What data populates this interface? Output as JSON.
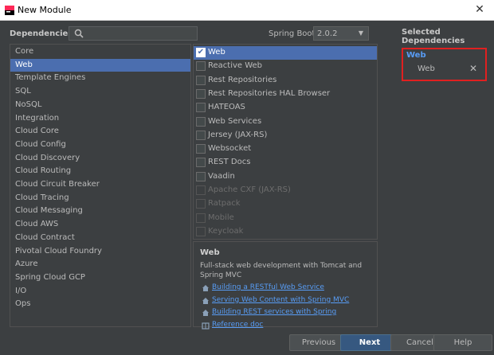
{
  "window": {
    "title": "New Module"
  },
  "toolbar": {
    "dependencies_label": "Dependencies",
    "search_placeholder": "",
    "spring_boot_label": "Spring Boot",
    "spring_boot_version": "2.0.2"
  },
  "categories": [
    "Core",
    "Web",
    "Template Engines",
    "SQL",
    "NoSQL",
    "Integration",
    "Cloud Core",
    "Cloud Config",
    "Cloud Discovery",
    "Cloud Routing",
    "Cloud Circuit Breaker",
    "Cloud Tracing",
    "Cloud Messaging",
    "Cloud AWS",
    "Cloud Contract",
    "Pivotal Cloud Foundry",
    "Azure",
    "Spring Cloud GCP",
    "I/O",
    "Ops"
  ],
  "selected_category_index": 1,
  "dependencies": [
    {
      "label": "Web",
      "checked": true,
      "enabled": true
    },
    {
      "label": "Reactive Web",
      "checked": false,
      "enabled": true
    },
    {
      "label": "Rest Repositories",
      "checked": false,
      "enabled": true
    },
    {
      "label": "Rest Repositories HAL Browser",
      "checked": false,
      "enabled": true
    },
    {
      "label": "HATEOAS",
      "checked": false,
      "enabled": true
    },
    {
      "label": "Web Services",
      "checked": false,
      "enabled": true
    },
    {
      "label": "Jersey (JAX-RS)",
      "checked": false,
      "enabled": true
    },
    {
      "label": "Websocket",
      "checked": false,
      "enabled": true
    },
    {
      "label": "REST Docs",
      "checked": false,
      "enabled": true
    },
    {
      "label": "Vaadin",
      "checked": false,
      "enabled": true
    },
    {
      "label": "Apache CXF (JAX-RS)",
      "checked": false,
      "enabled": false
    },
    {
      "label": "Ratpack",
      "checked": false,
      "enabled": false
    },
    {
      "label": "Mobile",
      "checked": false,
      "enabled": false
    },
    {
      "label": "Keycloak",
      "checked": false,
      "enabled": false
    }
  ],
  "description": {
    "title": "Web",
    "text": "Full-stack web development with Tomcat and Spring MVC",
    "links": [
      {
        "icon": "home-icon",
        "label": "Building a RESTful Web Service"
      },
      {
        "icon": "home-icon",
        "label": "Serving Web Content with Spring MVC"
      },
      {
        "icon": "home-icon",
        "label": "Building REST services with Spring"
      },
      {
        "icon": "book-icon",
        "label": "Reference doc"
      }
    ]
  },
  "selected_dependencies": {
    "label": "Selected Dependencies",
    "group": "Web",
    "items": [
      "Web"
    ]
  },
  "buttons": {
    "previous": "Previous",
    "next": "Next",
    "cancel": "Cancel",
    "help": "Help"
  },
  "colors": {
    "selection": "#4b6eaf",
    "link": "#589df6",
    "highlight_border": "#e02020"
  }
}
